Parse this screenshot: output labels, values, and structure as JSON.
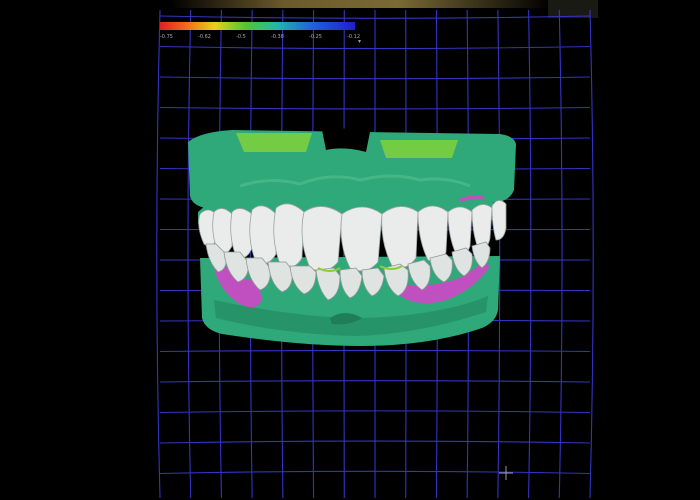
{
  "scale": {
    "labels": [
      "-0.75",
      "-0.62",
      "-0.5",
      "-0.38",
      "-0.25",
      "-0.12"
    ],
    "chevron": "▾",
    "colors": [
      "#e02020",
      "#f07018",
      "#e8d020",
      "#50c830",
      "#20b8a8",
      "#2060e0",
      "#2020c8"
    ]
  },
  "grid": {
    "color": "#3a3ad8"
  },
  "model": {
    "gum_color": "#2fa87a",
    "tooth_color": "#e9eceb",
    "tissue_color": "#c050c0",
    "highlight_color": "#8ad030"
  },
  "cursor": {
    "icon": "crosshair-icon"
  }
}
